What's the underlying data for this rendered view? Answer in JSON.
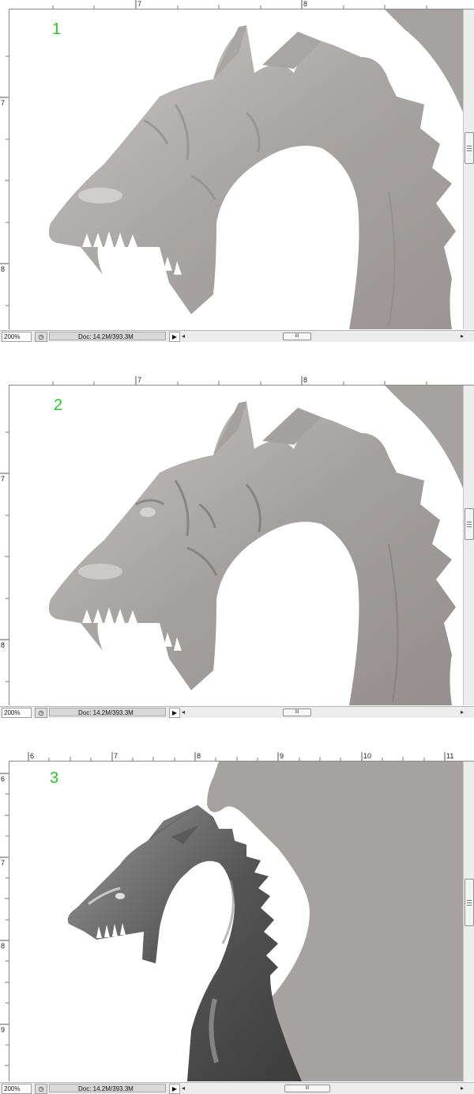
{
  "panels": [
    {
      "number": "1",
      "ruler_top": [
        "7",
        "8"
      ],
      "ruler_left": [
        "7",
        "8"
      ],
      "status": {
        "zoom": "200%",
        "doc": "Doc: 14.2M/393.3M",
        "scroll_thumb": "III"
      }
    },
    {
      "number": "2",
      "ruler_top": [
        "7",
        "8"
      ],
      "ruler_left": [
        "7",
        "8"
      ],
      "status": {
        "zoom": "200%",
        "doc": "Doc: 14.2M/393.3M",
        "scroll_thumb": "III"
      }
    },
    {
      "number": "3",
      "ruler_top": [
        "6",
        "7",
        "8",
        "9",
        "10",
        "11"
      ],
      "ruler_left": [
        "6",
        "7",
        "8",
        "9"
      ],
      "status": {
        "zoom": "200%",
        "doc": "Doc: 14.2M/393.3M",
        "scroll_thumb": "III"
      }
    }
  ],
  "colors": {
    "panel_number": "#22cc22",
    "dragon_gray": "#a7a2a2",
    "background_shape": "#a7a2a2",
    "canvas": "#ffffff"
  },
  "icons": {
    "status_icon": "clock-icon",
    "status_arrow": "triangle-right-icon",
    "scroll_left": "arrow-left-icon",
    "scroll_right": "arrow-right-icon"
  }
}
